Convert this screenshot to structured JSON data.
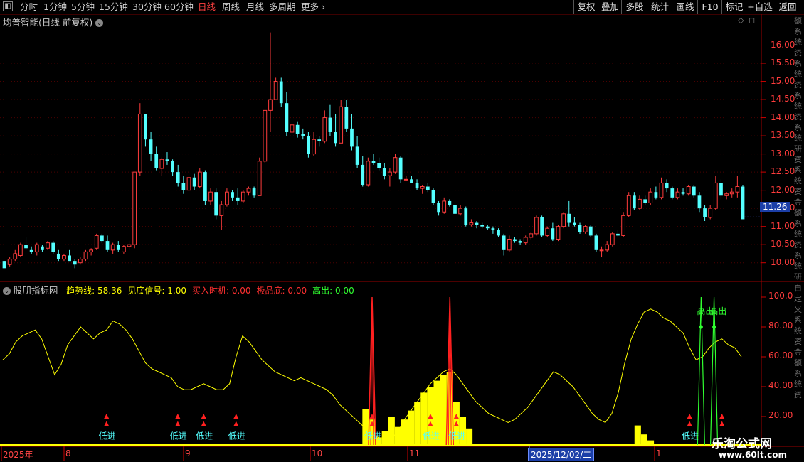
{
  "toolbar": {
    "periods": [
      "分时",
      "1分钟",
      "5分钟",
      "15分钟",
      "30分钟",
      "60分钟",
      "日线",
      "周线",
      "月线",
      "多周期",
      "更多"
    ],
    "active_period": "日线",
    "buttons": [
      "复权",
      "叠加",
      "多股",
      "统计",
      "画线",
      "F10",
      "标记",
      "+自选",
      "返回"
    ]
  },
  "price_panel": {
    "title": "均普智能(日线 前复权)",
    "current_price_tag": "11.26",
    "y_axis_ticks": [
      "16.00",
      "15.50",
      "15.00",
      "14.50",
      "14.00",
      "13.50",
      "13.00",
      "12.50",
      "12.00",
      "11.50",
      "11.00",
      "10.50",
      "10.00"
    ],
    "right_strip_text": "额系统资系统资系统资系统研资系统资金额系统资系统研资系统资系统资系统资系统交个书特"
  },
  "indicator_panel": {
    "name": "股朋指标网",
    "values": [
      {
        "label": "趋势线",
        "value": "58.36",
        "color": "#ffff00"
      },
      {
        "label": "见底信号",
        "value": "1.00",
        "color": "#ffff00"
      },
      {
        "label": "买入时机",
        "value": "0.00",
        "color": "#ff3030"
      },
      {
        "label": "极品底",
        "value": "0.00",
        "color": "#ff3030"
      },
      {
        "label": "高出",
        "value": "0.00",
        "color": "#30ff30"
      }
    ],
    "y_axis_ticks": [
      "100.0",
      "80.00",
      "60.00",
      "40.00",
      "20.00"
    ],
    "signal_low": "低进",
    "signal_high": "高出"
  },
  "date_axis": {
    "labels": [
      "2025年",
      "8",
      "9",
      "10",
      "11",
      "1"
    ],
    "selected_date": "2025/12/02/二"
  },
  "watermark": {
    "line1": "乐淘公式网",
    "line2": "www.60lt.com"
  },
  "colors": {
    "up": "#ff3c3c",
    "down": "#54ffff",
    "trend": "#ffff00",
    "buy_spike": "#ff2020",
    "high_out": "#30ff30"
  },
  "chart_data": {
    "type": "candlestick",
    "y_range": [
      9.7,
      16.5
    ],
    "candles": [
      [
        10.05,
        10.05,
        9.9,
        9.85
      ],
      [
        9.95,
        10.15,
        9.9,
        10.1
      ],
      [
        10.1,
        10.35,
        10.05,
        10.25
      ],
      [
        10.2,
        10.55,
        10.15,
        10.5
      ],
      [
        10.5,
        10.7,
        10.35,
        10.4
      ],
      [
        10.35,
        10.45,
        10.25,
        10.3
      ],
      [
        10.3,
        10.55,
        10.2,
        10.5
      ],
      [
        10.45,
        10.5,
        10.3,
        10.35
      ],
      [
        10.4,
        10.6,
        10.35,
        10.55
      ],
      [
        10.55,
        10.6,
        10.25,
        10.3
      ],
      [
        10.25,
        10.35,
        10.05,
        10.1
      ],
      [
        10.1,
        10.25,
        10.05,
        10.2
      ],
      [
        10.2,
        10.35,
        10.1,
        10.05
      ],
      [
        10.05,
        10.1,
        9.85,
        9.95
      ],
      [
        10.0,
        10.15,
        9.95,
        10.1
      ],
      [
        10.1,
        10.35,
        10.05,
        10.3
      ],
      [
        10.3,
        10.4,
        10.2,
        10.35
      ],
      [
        10.4,
        10.8,
        10.35,
        10.75
      ],
      [
        10.75,
        10.8,
        10.55,
        10.6
      ],
      [
        10.6,
        10.75,
        10.3,
        10.35
      ],
      [
        10.35,
        10.55,
        10.25,
        10.5
      ],
      [
        10.5,
        10.6,
        10.3,
        10.35
      ],
      [
        10.3,
        10.5,
        10.25,
        10.45
      ],
      [
        10.45,
        10.6,
        10.35,
        10.5
      ],
      [
        10.5,
        12.5,
        10.4,
        12.5
      ],
      [
        12.5,
        14.4,
        12.4,
        14.1
      ],
      [
        14.1,
        14.1,
        13.2,
        13.4
      ],
      [
        13.4,
        13.6,
        12.8,
        13.0
      ],
      [
        13.0,
        13.2,
        12.55,
        12.6
      ],
      [
        12.6,
        12.9,
        12.4,
        12.85
      ],
      [
        12.85,
        13.05,
        12.7,
        12.8
      ],
      [
        12.8,
        12.85,
        12.4,
        12.5
      ],
      [
        12.5,
        12.7,
        12.1,
        12.2
      ],
      [
        12.2,
        12.4,
        11.9,
        12.0
      ],
      [
        12.0,
        12.5,
        11.95,
        12.35
      ],
      [
        12.35,
        12.45,
        12.0,
        12.1
      ],
      [
        12.1,
        12.6,
        12.05,
        12.5
      ],
      [
        12.5,
        12.55,
        11.6,
        11.7
      ],
      [
        11.7,
        12.05,
        11.6,
        11.95
      ],
      [
        11.95,
        12.05,
        11.2,
        11.3
      ],
      [
        11.3,
        11.7,
        10.9,
        11.6
      ],
      [
        11.6,
        12.05,
        11.55,
        11.95
      ],
      [
        11.95,
        12.0,
        11.7,
        11.8
      ],
      [
        11.8,
        12.05,
        11.6,
        11.7
      ],
      [
        11.7,
        12.0,
        11.65,
        11.95
      ],
      [
        11.95,
        12.1,
        11.85,
        12.05
      ],
      [
        12.05,
        12.1,
        11.8,
        11.85
      ],
      [
        11.85,
        12.9,
        11.85,
        12.8
      ],
      [
        12.8,
        14.0,
        12.75,
        14.2
      ],
      [
        14.2,
        16.35,
        13.6,
        14.5
      ],
      [
        14.5,
        15.1,
        14.7,
        15.0
      ],
      [
        15.0,
        15.1,
        14.3,
        14.4
      ],
      [
        14.4,
        14.7,
        13.5,
        13.6
      ],
      [
        13.6,
        14.2,
        13.4,
        13.8
      ],
      [
        13.8,
        13.9,
        13.45,
        13.55
      ],
      [
        13.55,
        13.7,
        13.4,
        13.5
      ],
      [
        13.5,
        13.6,
        12.9,
        13.0
      ],
      [
        13.0,
        13.6,
        12.95,
        13.4
      ],
      [
        13.4,
        13.5,
        13.2,
        13.35
      ],
      [
        13.35,
        14.2,
        13.3,
        14.0
      ],
      [
        14.0,
        14.35,
        13.5,
        13.6
      ],
      [
        13.6,
        14.1,
        13.2,
        13.3
      ],
      [
        13.3,
        14.5,
        13.3,
        14.3
      ],
      [
        14.3,
        14.5,
        13.6,
        13.7
      ],
      [
        13.7,
        14.1,
        13.1,
        13.2
      ],
      [
        13.2,
        13.5,
        12.6,
        12.7
      ],
      [
        12.7,
        12.95,
        12.1,
        12.15
      ],
      [
        12.15,
        12.9,
        12.1,
        12.8
      ],
      [
        12.8,
        13.0,
        12.7,
        12.75
      ],
      [
        12.75,
        12.9,
        12.55,
        12.6
      ],
      [
        12.6,
        12.75,
        12.3,
        12.4
      ],
      [
        12.4,
        12.6,
        12.1,
        12.5
      ],
      [
        12.5,
        13.0,
        12.45,
        12.9
      ],
      [
        12.9,
        12.95,
        12.2,
        12.3
      ],
      [
        12.3,
        12.4,
        12.25,
        12.3
      ],
      [
        12.3,
        12.4,
        12.2,
        12.2
      ],
      [
        12.2,
        12.3,
        12.0,
        12.05
      ],
      [
        12.05,
        12.15,
        11.9,
        12.1
      ],
      [
        12.1,
        12.2,
        11.95,
        12.0
      ],
      [
        12.0,
        12.05,
        11.6,
        11.65
      ],
      [
        11.65,
        11.7,
        11.3,
        11.4
      ],
      [
        11.4,
        11.8,
        11.35,
        11.7
      ],
      [
        11.7,
        11.75,
        11.55,
        11.6
      ],
      [
        11.6,
        11.7,
        11.3,
        11.35
      ],
      [
        11.35,
        11.6,
        11.3,
        11.5
      ],
      [
        11.5,
        11.55,
        11.0,
        11.05
      ],
      [
        11.05,
        11.2,
        11.0,
        11.1
      ],
      [
        11.1,
        11.15,
        10.95,
        11.05
      ],
      [
        11.05,
        11.1,
        10.95,
        11.0
      ],
      [
        11.0,
        11.05,
        10.9,
        10.95
      ],
      [
        10.95,
        11.0,
        10.8,
        10.9
      ],
      [
        10.9,
        10.95,
        10.7,
        10.75
      ],
      [
        10.75,
        10.8,
        10.2,
        10.35
      ],
      [
        10.35,
        10.75,
        10.3,
        10.65
      ],
      [
        10.65,
        10.7,
        10.55,
        10.6
      ],
      [
        10.6,
        10.65,
        10.5,
        10.55
      ],
      [
        10.55,
        10.75,
        10.5,
        10.7
      ],
      [
        10.7,
        10.85,
        10.65,
        10.8
      ],
      [
        10.8,
        11.3,
        10.75,
        11.25
      ],
      [
        11.25,
        11.3,
        10.7,
        10.75
      ],
      [
        10.75,
        11.0,
        10.7,
        10.95
      ],
      [
        10.95,
        11.1,
        10.6,
        10.65
      ],
      [
        10.65,
        11.05,
        10.6,
        11.0
      ],
      [
        11.0,
        11.4,
        10.95,
        11.35
      ],
      [
        11.35,
        11.7,
        11.0,
        11.1
      ],
      [
        11.1,
        11.25,
        11.0,
        11.05
      ],
      [
        11.05,
        11.1,
        10.8,
        10.85
      ],
      [
        10.85,
        11.05,
        10.8,
        11.0
      ],
      [
        11.0,
        11.05,
        10.7,
        10.75
      ],
      [
        10.75,
        10.8,
        10.3,
        10.35
      ],
      [
        10.35,
        10.45,
        10.15,
        10.35
      ],
      [
        10.35,
        10.6,
        10.3,
        10.5
      ],
      [
        10.5,
        10.85,
        10.45,
        10.8
      ],
      [
        10.8,
        10.9,
        10.7,
        10.75
      ],
      [
        10.75,
        11.4,
        10.7,
        11.3
      ],
      [
        11.3,
        11.95,
        11.25,
        11.85
      ],
      [
        11.85,
        11.95,
        11.45,
        11.5
      ],
      [
        11.5,
        11.85,
        11.45,
        11.75
      ],
      [
        11.75,
        11.85,
        11.6,
        11.65
      ],
      [
        11.65,
        12.05,
        11.6,
        11.95
      ],
      [
        11.95,
        12.1,
        11.75,
        11.8
      ],
      [
        11.8,
        12.35,
        11.75,
        12.2
      ],
      [
        12.2,
        12.3,
        11.95,
        12.05
      ],
      [
        12.05,
        12.1,
        11.75,
        11.8
      ],
      [
        11.8,
        12.05,
        11.75,
        11.95
      ],
      [
        11.95,
        12.05,
        11.85,
        11.9
      ],
      [
        11.9,
        12.15,
        11.85,
        12.1
      ],
      [
        12.1,
        12.15,
        11.8,
        11.85
      ],
      [
        11.85,
        11.95,
        11.4,
        11.5
      ],
      [
        11.5,
        11.6,
        11.15,
        11.25
      ],
      [
        11.25,
        11.6,
        11.2,
        11.5
      ],
      [
        11.5,
        12.4,
        11.45,
        12.2
      ],
      [
        12.2,
        12.3,
        11.75,
        11.85
      ],
      [
        11.85,
        11.95,
        11.75,
        11.9
      ],
      [
        11.9,
        12.05,
        11.8,
        11.95
      ],
      [
        11.95,
        12.4,
        11.8,
        12.1
      ],
      [
        12.1,
        12.15,
        11.6,
        11.2
      ]
    ],
    "trend_series": [
      58,
      62,
      70,
      74,
      76,
      78,
      72,
      60,
      48,
      55,
      68,
      74,
      80,
      76,
      72,
      76,
      78,
      84,
      82,
      78,
      72,
      64,
      56,
      52,
      50,
      48,
      46,
      40,
      38,
      38,
      40,
      42,
      40,
      38,
      38,
      42,
      60,
      74,
      70,
      64,
      58,
      54,
      50,
      48,
      46,
      44,
      46,
      44,
      42,
      40,
      38,
      34,
      28,
      24,
      20,
      16,
      12,
      8,
      6,
      4,
      5,
      10,
      18,
      24,
      30,
      36,
      42,
      46,
      50,
      52,
      48,
      42,
      36,
      30,
      26,
      22,
      20,
      18,
      16,
      18,
      22,
      26,
      32,
      38,
      44,
      50,
      48,
      44,
      40,
      34,
      28,
      22,
      18,
      16,
      22,
      36,
      56,
      72,
      82,
      90,
      92,
      90,
      86,
      84,
      80,
      76,
      66,
      58,
      60,
      66,
      70,
      72,
      68,
      66,
      60
    ]
  }
}
